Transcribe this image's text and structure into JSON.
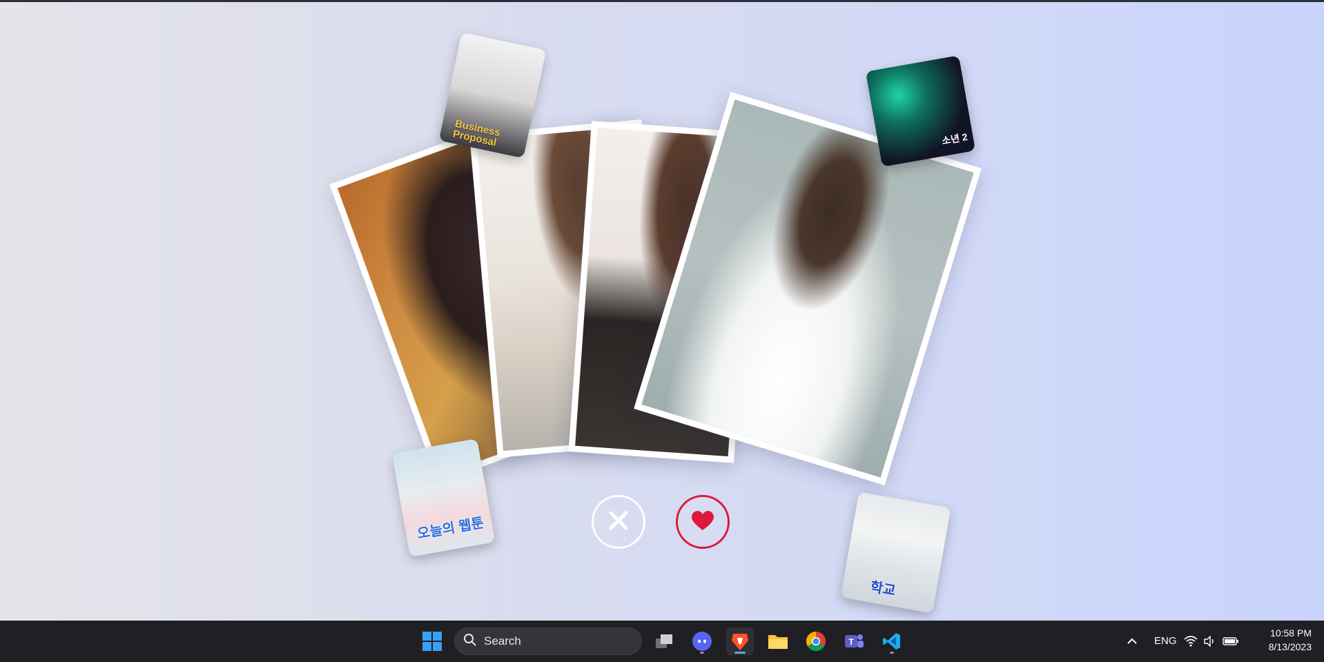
{
  "photo_stack": {
    "cards": [
      {
        "name": "photo-card-1",
        "description_icon": "portrait-photo"
      },
      {
        "name": "photo-card-2",
        "description_icon": "portrait-photo"
      },
      {
        "name": "photo-card-3",
        "description_icon": "portrait-photo"
      },
      {
        "name": "photo-card-4",
        "description_icon": "portrait-photo"
      }
    ]
  },
  "posters": {
    "top_left_caption": "Business Proposal",
    "top_right_caption": "소년 2",
    "bottom_left_caption": "오늘의 웹툰",
    "bottom_right_caption": "학교"
  },
  "actions": {
    "reject_icon": "close-icon",
    "like_icon": "heart-icon",
    "reject_color": "#ffffff",
    "like_color": "#e0173c"
  },
  "taskbar": {
    "search_label": "Search",
    "language": "ENG",
    "time": "10:58 PM",
    "date": "8/13/2023",
    "apps": [
      "windows-start",
      "task-view",
      "discord",
      "brave",
      "file-explorer",
      "chrome",
      "teams",
      "vscode"
    ]
  }
}
